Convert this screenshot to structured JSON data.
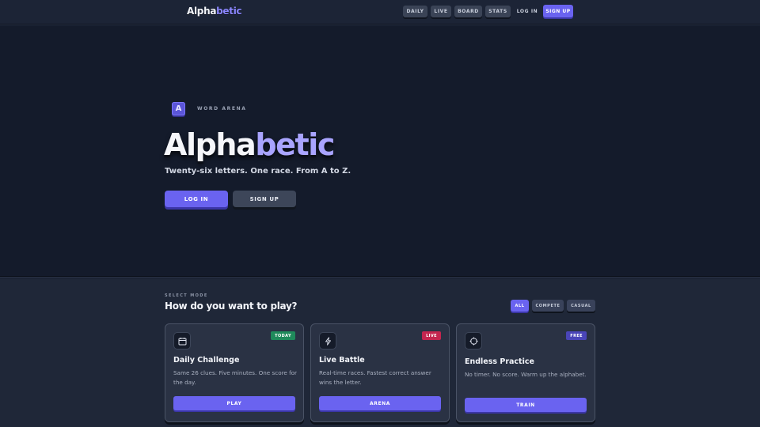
{
  "nav": {
    "brand_main": "Alpha",
    "brand_accent": "betic",
    "links": [
      "DAILY",
      "LIVE",
      "BOARD",
      "STATS"
    ],
    "login": "LOG IN",
    "signup": "SIGN UP"
  },
  "hero": {
    "logo_letter": "A",
    "eyebrow": "WORD ARENA",
    "title_main": "Alpha",
    "title_accent": "betic",
    "tagline": "Twenty-six letters. One race. From A to Z.",
    "login": "LOG IN",
    "signup": "SIGN UP"
  },
  "modes": {
    "label": "SELECT MODE",
    "title": "How do you want to play?",
    "filters": [
      "ALL",
      "COMPETE",
      "CASUAL"
    ],
    "cards": [
      {
        "icon": "calendar-icon",
        "badge": "TODAY",
        "title": "Daily Challenge",
        "desc": "Same 26 clues. Five minutes. One score for the day.",
        "button": "PLAY"
      },
      {
        "icon": "lightning-icon",
        "badge": "LIVE",
        "title": "Live Battle",
        "desc": "Real-time races. Fastest correct answer wins the letter.",
        "button": "ARENA"
      },
      {
        "icon": "target-icon",
        "badge": "FREE",
        "title": "Endless Practice",
        "desc": "No timer. No score. Warm up the alphabet.",
        "button": "TRAIN"
      }
    ]
  },
  "colors": {
    "accent": "#6a63f0",
    "accent_text": "#a9a4ff",
    "background": "#141b2b",
    "badge_today": "#1f8a5b",
    "badge_live": "#c4254f",
    "badge_free": "#4a45b8"
  }
}
